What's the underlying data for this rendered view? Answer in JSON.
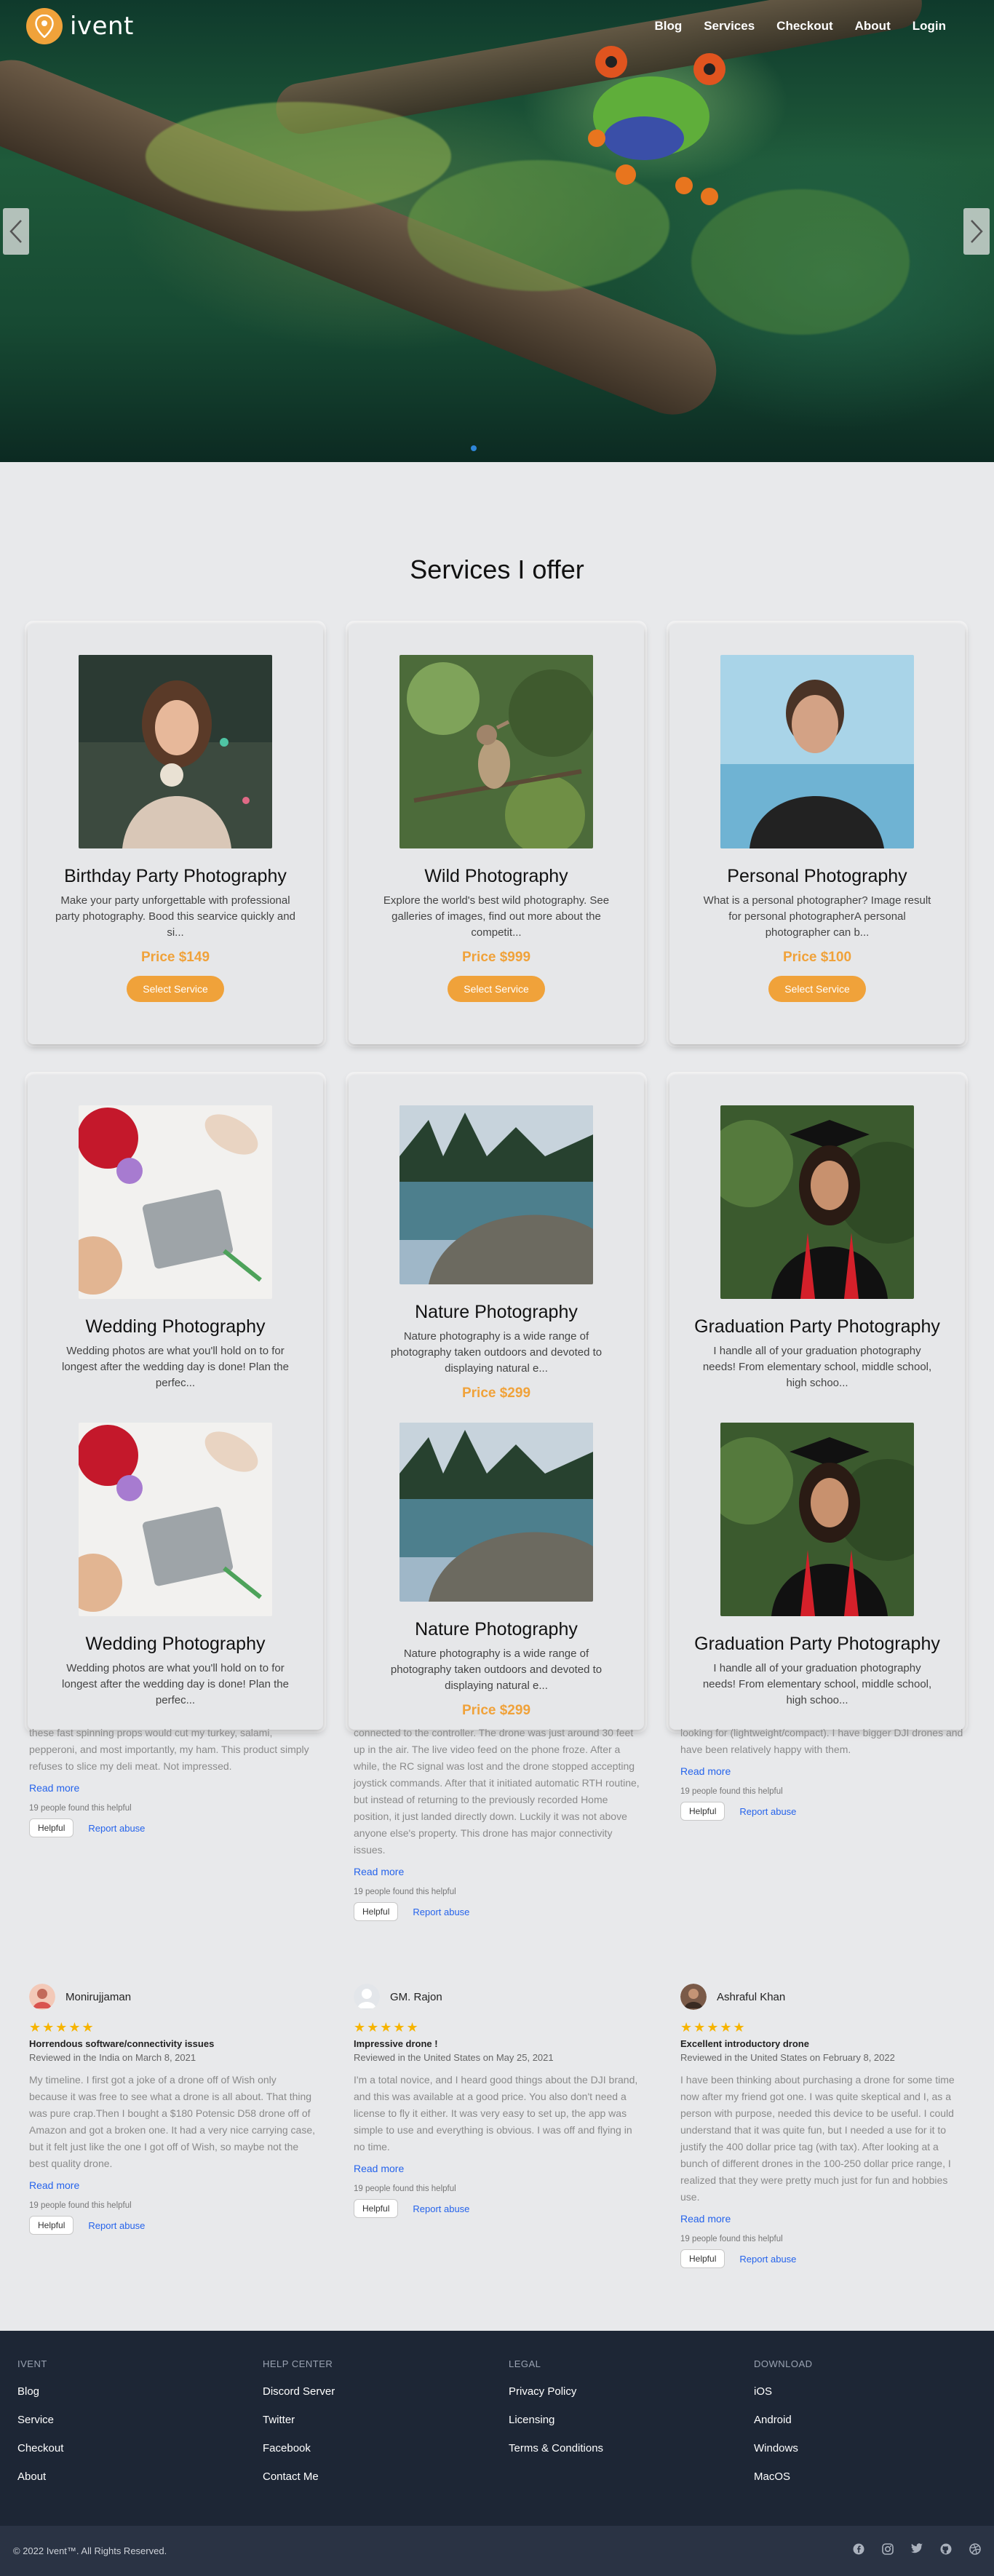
{
  "nav": {
    "brand": "ivent",
    "links": [
      "Blog",
      "Services",
      "Checkout",
      "About",
      "Login"
    ]
  },
  "hero": {
    "prev_icon": "chevron-left-icon",
    "next_icon": "chevron-right-icon",
    "dot_color": "#2f86d8"
  },
  "services": {
    "title": "Services I offer",
    "cards": [
      {
        "title": "Birthday Party Photography",
        "desc": "Make your party unforgettable with professional party photography. Bood this searvice quickly and si...",
        "price": "Price $149",
        "button": "Select Service"
      },
      {
        "title": "Wild Photography",
        "desc": "Explore the world's best wild photography. See galleries of images, find out more about the competit...",
        "price": "Price $999",
        "button": "Select Service"
      },
      {
        "title": "Personal Photography",
        "desc": "What is a personal photographer? Image result for personal photographerA personal photographer can b...",
        "price": "Price $100",
        "button": "Select Service"
      },
      {
        "title": "Wedding Photography",
        "desc": "Wedding photos are what you'll hold on to for longest after the wedding day is done! Plan the perfec..."
      },
      {
        "title": "Nature Photography",
        "desc": "Nature photography is a wide range of photography taken outdoors and devoted to displaying natural e...",
        "price": "Price $299"
      },
      {
        "title": "Graduation Party Photography",
        "desc": "I handle all of your graduation photography needs! From elementary school, middle school, high schoo..."
      },
      {
        "title": "Wedding Photography",
        "desc": "Wedding photos are what you'll hold on to for longest after the wedding day is done! Plan the perfec..."
      },
      {
        "title": "Nature Photography",
        "desc": "Nature photography is a wide range of photography taken outdoors and devoted to displaying natural e...",
        "price": "Price $299"
      },
      {
        "title": "Graduation Party Photography",
        "desc": "I handle all of your graduation photography needs! From elementary school, middle school, high schoo..."
      }
    ]
  },
  "reviews_top": [
    {
      "text": "these fast spinning props would cut my turkey, salami, pepperoni, and most importantly, my ham. This product simply refuses to slice my deli meat. Not impressed.",
      "read_more": "Read more",
      "helpful_count": "19 people found this helpful",
      "helpful": "Helpful",
      "report": "Report abuse"
    },
    {
      "text": "connected to the controller. The drone was just around 30 feet up in the air. The live video feed on the phone froze. After a while, the RC signal was lost and the drone stopped accepting joystick commands. After that it initiated automatic RTH routine, but instead of returning to the previously recorded Home position, it just landed directly down. Luckily it was not above anyone else's property. This drone has major connectivity issues.",
      "read_more": "Read more",
      "helpful_count": "19 people found this helpful",
      "helpful": "Helpful",
      "report": "Report abuse"
    },
    {
      "text": "looking for (lightweight/compact). I have bigger DJI drones and have been relatively happy with them.",
      "read_more": "Read more",
      "helpful_count": "19 people found this helpful",
      "helpful": "Helpful",
      "report": "Report abuse"
    }
  ],
  "reviews": [
    {
      "name": "Monirujjaman",
      "stars": "★★★★★",
      "title": "Horrendous software/connectivity issues",
      "meta": "Reviewed in the India on March 8, 2021",
      "text": "My timeline. I first got a joke of a drone off of Wish only because it was free to see what a drone is all about. That thing was pure crap.Then I bought a $180 Potensic D58 drone off of Amazon and got a broken one. It had a very nice carrying case, but it felt just like the one I got off of Wish, so maybe not the best quality drone.",
      "read_more": "Read more",
      "helpful_count": "19 people found this helpful",
      "helpful": "Helpful",
      "report": "Report abuse"
    },
    {
      "name": "GM. Rajon",
      "stars": "★★★★★",
      "title": "Impressive drone !",
      "meta": "Reviewed in the United States on May 25, 2021",
      "text": "I'm a total novice, and I heard good things about the DJI brand, and this was available at a good price. You also don't need a license to fly it either. It was very easy to set up, the app was simple to use and everything is obvious. I was off and flying in no time.",
      "read_more": "Read more",
      "helpful_count": "19 people found this helpful",
      "helpful": "Helpful",
      "report": "Report abuse"
    },
    {
      "name": "Ashraful Khan",
      "stars": "★★★★★",
      "title": "Excellent introductory drone",
      "meta": "Reviewed in the United States on February 8, 2022",
      "text": "I have been thinking about purchasing a drone for some time now after my friend got one. I was quite skeptical and I, as a person with purpose, needed this device to be useful. I could understand that it was quite fun, but I needed a use for it to justify the 400 dollar price tag (with tax). After looking at a bunch of different drones in the 100-250 dollar price range, I realized that they were pretty much just for fun and hobbies use.",
      "read_more": "Read more",
      "helpful_count": "19 people found this helpful",
      "helpful": "Helpful",
      "report": "Report abuse"
    }
  ],
  "footer": {
    "cols": [
      {
        "head": "IVENT",
        "items": [
          "Blog",
          "Service",
          "Checkout",
          "About"
        ]
      },
      {
        "head": "HELP CENTER",
        "items": [
          "Discord Server",
          "Twitter",
          "Facebook",
          "Contact Me"
        ]
      },
      {
        "head": "LEGAL",
        "items": [
          "Privacy Policy",
          "Licensing",
          "Terms & Conditions"
        ]
      },
      {
        "head": "DOWNLOAD",
        "items": [
          "iOS",
          "Android",
          "Windows",
          "MacOS"
        ]
      }
    ],
    "copyright": "© 2022 Ivent™. All Rights Reserved.",
    "social_icons": [
      "facebook-icon",
      "instagram-icon",
      "twitter-icon",
      "github-icon",
      "dribbble-icon"
    ]
  },
  "colors": {
    "accent": "#f0a23a",
    "link": "#2563eb",
    "footer": "#1d2635",
    "star": "#f6b400"
  }
}
